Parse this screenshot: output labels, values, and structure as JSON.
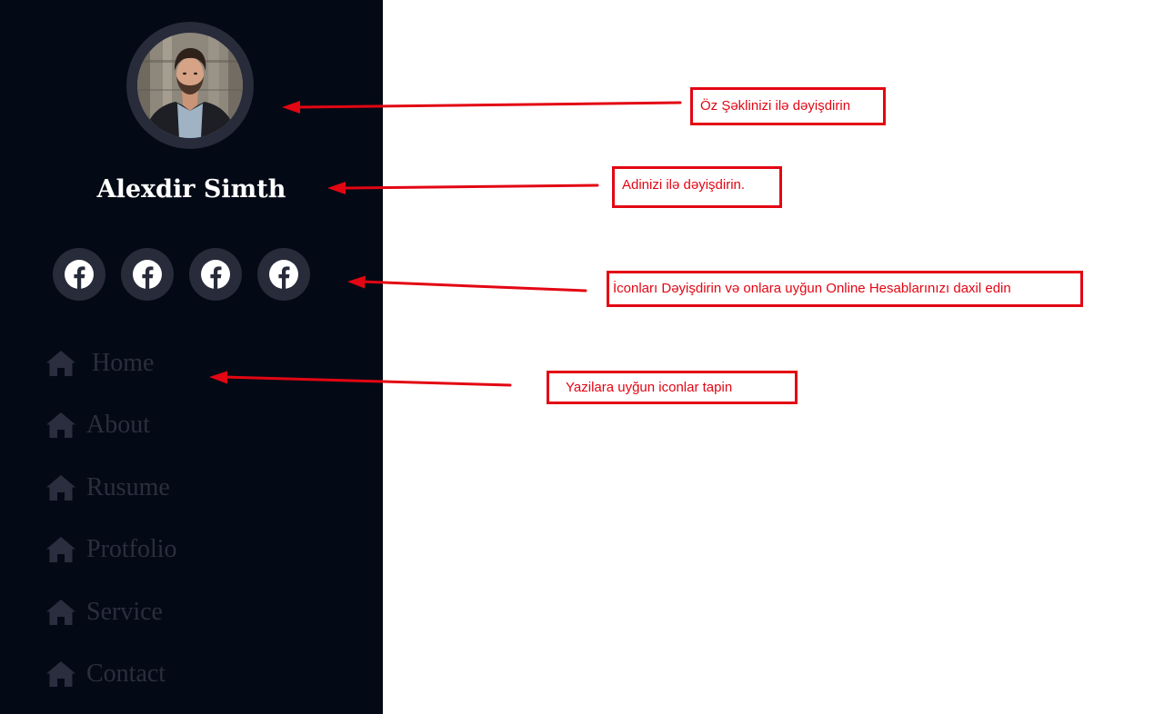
{
  "profile": {
    "name": "Alexdir Simth"
  },
  "socials": [
    {
      "icon": "facebook-icon"
    },
    {
      "icon": "facebook-icon"
    },
    {
      "icon": "facebook-icon"
    },
    {
      "icon": "facebook-icon"
    }
  ],
  "nav": {
    "items": [
      {
        "label": "Home",
        "icon": "home-icon"
      },
      {
        "label": "About",
        "icon": "home-icon"
      },
      {
        "label": "Rusume",
        "icon": "home-icon"
      },
      {
        "label": "Protfolio",
        "icon": "home-icon"
      },
      {
        "label": "Service",
        "icon": "home-icon"
      },
      {
        "label": "Contact",
        "icon": "home-icon"
      }
    ]
  },
  "annotations": {
    "photo": "Öz Şəklinizi ilə dəyişdirin",
    "name": "Adinizi ilə dəyişdirin.",
    "icons": "İconları Dəyişdirin və onlara uyğun Online Hesablarınızı daxil edin",
    "nav": "Yazilara uyğun iconlar tapin"
  },
  "colors": {
    "sidebar_bg": "#040a15",
    "circle_bg": "#272b3a",
    "nav_text": "#2a2e3e",
    "annotation_red": "#e30613",
    "content_bg": "#ffffff"
  }
}
